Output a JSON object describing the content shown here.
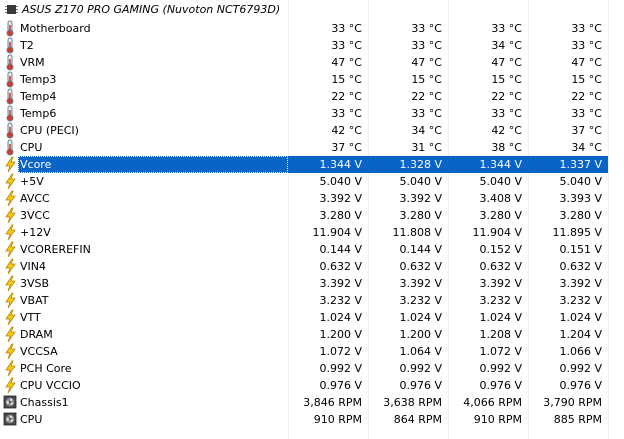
{
  "header": {
    "title": "ASUS Z170 PRO GAMING (Nuvoton NCT6793D)"
  },
  "rows": [
    {
      "name": "Motherboard",
      "icon": "thermometer-icon",
      "values": [
        "33 °C",
        "33 °C",
        "33 °C",
        "33 °C"
      ]
    },
    {
      "name": "T2",
      "icon": "thermometer-icon",
      "values": [
        "33 °C",
        "33 °C",
        "34 °C",
        "33 °C"
      ]
    },
    {
      "name": "VRM",
      "icon": "thermometer-icon",
      "values": [
        "47 °C",
        "47 °C",
        "47 °C",
        "47 °C"
      ]
    },
    {
      "name": "Temp3",
      "icon": "thermometer-icon",
      "values": [
        "15 °C",
        "15 °C",
        "15 °C",
        "15 °C"
      ]
    },
    {
      "name": "Temp4",
      "icon": "thermometer-icon",
      "values": [
        "22 °C",
        "22 °C",
        "22 °C",
        "22 °C"
      ]
    },
    {
      "name": "Temp6",
      "icon": "thermometer-icon",
      "values": [
        "33 °C",
        "33 °C",
        "33 °C",
        "33 °C"
      ]
    },
    {
      "name": "CPU (PECI)",
      "icon": "thermometer-icon",
      "values": [
        "42 °C",
        "34 °C",
        "42 °C",
        "37 °C"
      ]
    },
    {
      "name": "CPU",
      "icon": "thermometer-icon",
      "values": [
        "37 °C",
        "31 °C",
        "38 °C",
        "34 °C"
      ]
    },
    {
      "name": "Vcore",
      "icon": "lightning-icon",
      "selected": true,
      "values": [
        "1.344 V",
        "1.328 V",
        "1.344 V",
        "1.337 V"
      ]
    },
    {
      "name": "+5V",
      "icon": "lightning-icon",
      "values": [
        "5.040 V",
        "5.040 V",
        "5.040 V",
        "5.040 V"
      ]
    },
    {
      "name": "AVCC",
      "icon": "lightning-icon",
      "values": [
        "3.392 V",
        "3.392 V",
        "3.408 V",
        "3.393 V"
      ]
    },
    {
      "name": "3VCC",
      "icon": "lightning-icon",
      "values": [
        "3.280 V",
        "3.280 V",
        "3.280 V",
        "3.280 V"
      ]
    },
    {
      "name": "+12V",
      "icon": "lightning-icon",
      "values": [
        "11.904 V",
        "11.808 V",
        "11.904 V",
        "11.895 V"
      ]
    },
    {
      "name": "VCOREREFIN",
      "icon": "lightning-icon",
      "values": [
        "0.144 V",
        "0.144 V",
        "0.152 V",
        "0.151 V"
      ]
    },
    {
      "name": "VIN4",
      "icon": "lightning-icon",
      "values": [
        "0.632 V",
        "0.632 V",
        "0.632 V",
        "0.632 V"
      ]
    },
    {
      "name": "3VSB",
      "icon": "lightning-icon",
      "values": [
        "3.392 V",
        "3.392 V",
        "3.392 V",
        "3.392 V"
      ]
    },
    {
      "name": "VBAT",
      "icon": "lightning-icon",
      "values": [
        "3.232 V",
        "3.232 V",
        "3.232 V",
        "3.232 V"
      ]
    },
    {
      "name": "VTT",
      "icon": "lightning-icon",
      "values": [
        "1.024 V",
        "1.024 V",
        "1.024 V",
        "1.024 V"
      ]
    },
    {
      "name": "DRAM",
      "icon": "lightning-icon",
      "values": [
        "1.200 V",
        "1.200 V",
        "1.208 V",
        "1.204 V"
      ]
    },
    {
      "name": "VCCSA",
      "icon": "lightning-icon",
      "values": [
        "1.072 V",
        "1.064 V",
        "1.072 V",
        "1.066 V"
      ]
    },
    {
      "name": "PCH Core",
      "icon": "lightning-icon",
      "values": [
        "0.992 V",
        "0.992 V",
        "0.992 V",
        "0.992 V"
      ]
    },
    {
      "name": "CPU VCCIO",
      "icon": "lightning-icon",
      "values": [
        "0.976 V",
        "0.976 V",
        "0.976 V",
        "0.976 V"
      ]
    },
    {
      "name": "Chassis1",
      "icon": "fan-icon",
      "values": [
        "3,846 RPM",
        "3,638 RPM",
        "4,066 RPM",
        "3,790 RPM"
      ]
    },
    {
      "name": "CPU",
      "icon": "fan-icon",
      "values": [
        "910 RPM",
        "864 RPM",
        "910 RPM",
        "885 RPM"
      ]
    }
  ]
}
